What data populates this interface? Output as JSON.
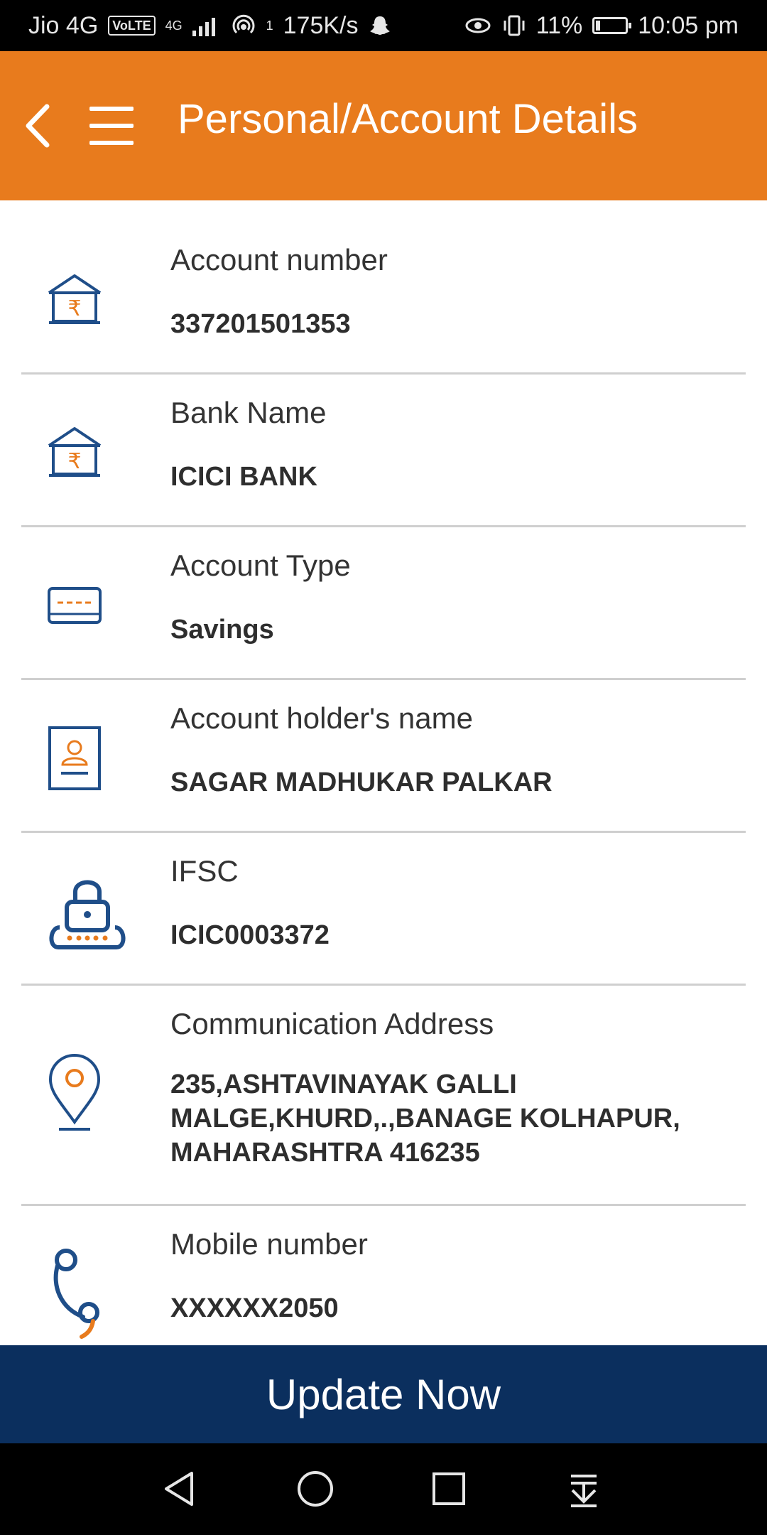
{
  "status_bar": {
    "carrier": "Jio 4G",
    "volte": "VoLTE",
    "network_type": "4G",
    "hotspot_count": "1",
    "speed": "175K/s",
    "battery": "11%",
    "time": "10:05 pm"
  },
  "header": {
    "title": "Personal/Account Details"
  },
  "details": [
    {
      "label": "Account number",
      "value": "337201501353",
      "icon": "bank-icon"
    },
    {
      "label": "Bank Name",
      "value": "ICICI BANK",
      "icon": "bank-icon"
    },
    {
      "label": "Account Type",
      "value": "Savings",
      "icon": "card-icon"
    },
    {
      "label": "Account holder's name",
      "value": "SAGAR MADHUKAR PALKAR",
      "icon": "id-card-icon"
    },
    {
      "label": "IFSC",
      "value": "ICIC0003372",
      "icon": "lock-icon"
    },
    {
      "label": "Communication Address",
      "value_lines": [
        "235,ASHTAVINAYAK GALLI",
        "MALGE,KHURD,.,BANAGE KOLHAPUR,",
        "MAHARASHTRA 416235"
      ],
      "icon": "location-pin-icon"
    },
    {
      "label": "Mobile number",
      "value": "XXXXXX2050",
      "icon": "phone-icon"
    }
  ],
  "update_button": {
    "label": "Update Now"
  },
  "colors": {
    "header_bg": "#e87b1d",
    "button_bg": "#0b2f5e",
    "icon_blue": "#1f4e89",
    "icon_orange": "#e87b1d"
  }
}
